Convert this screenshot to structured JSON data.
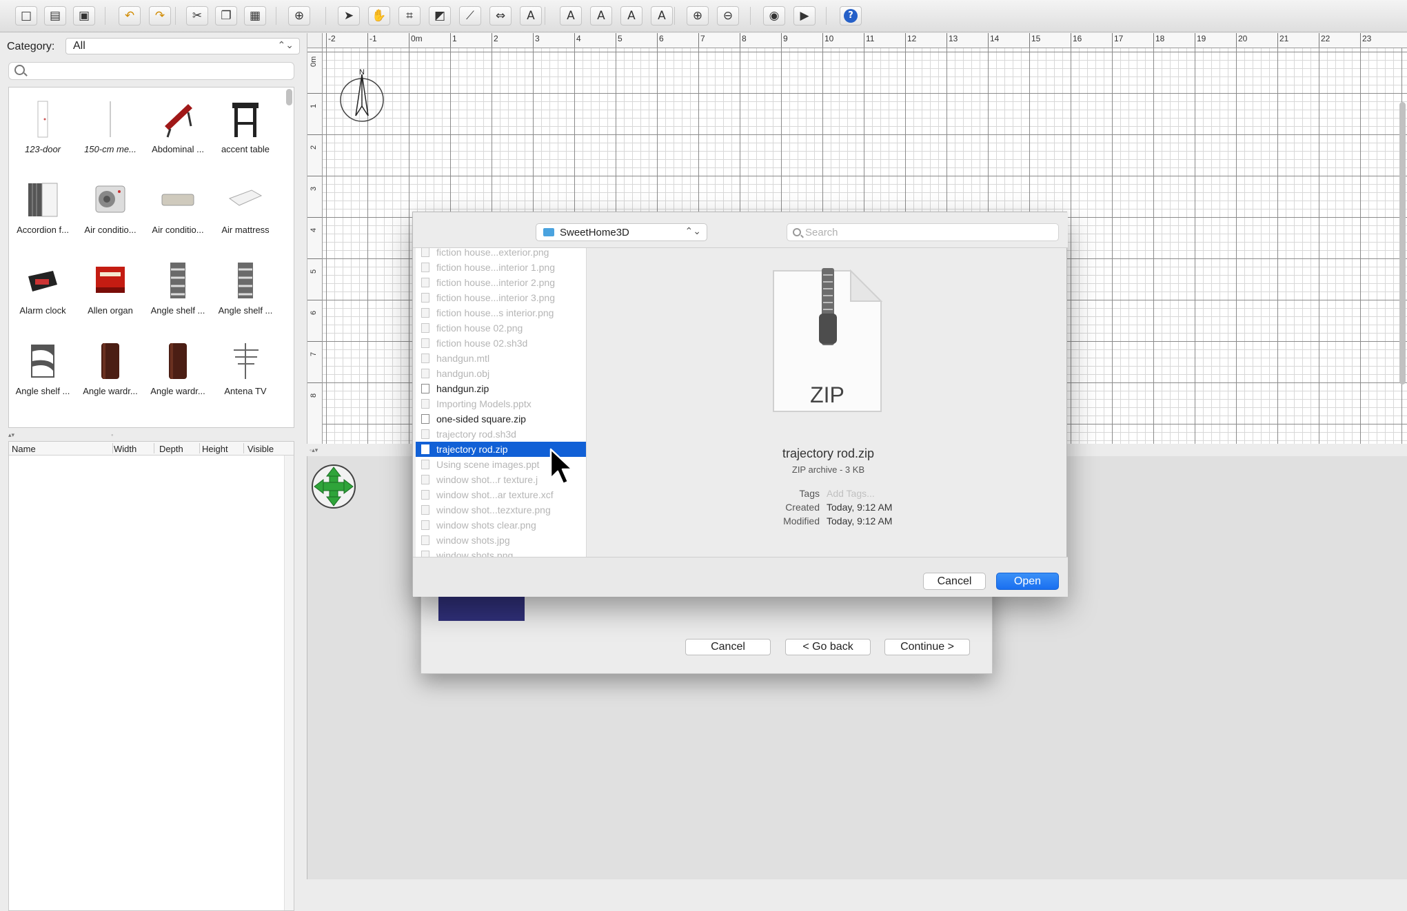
{
  "toolbar": {
    "buttons": [
      {
        "name": "new-home-button",
        "icon": "□"
      },
      {
        "name": "open-button",
        "icon": "▤"
      },
      {
        "name": "save-button",
        "icon": "▣"
      },
      {
        "name": "undo-button",
        "icon": "↶"
      },
      {
        "name": "redo-button",
        "icon": "↷"
      },
      {
        "name": "cut-button",
        "icon": "✂"
      },
      {
        "name": "copy-button",
        "icon": "❐"
      },
      {
        "name": "paste-button",
        "icon": "▦"
      },
      {
        "name": "add-furniture-button",
        "icon": "⊕"
      },
      {
        "name": "select-mode-button",
        "icon": "➤"
      },
      {
        "name": "pan-mode-button",
        "icon": "✋"
      },
      {
        "name": "create-walls-button",
        "icon": "⌗"
      },
      {
        "name": "create-rooms-button",
        "icon": "◩"
      },
      {
        "name": "create-polylines-button",
        "icon": "⟋"
      },
      {
        "name": "create-dimensions-button",
        "icon": "⇔"
      },
      {
        "name": "add-text-button",
        "icon": "A"
      },
      {
        "name": "increase-text-size-button",
        "icon": "A"
      },
      {
        "name": "decrease-text-size-button",
        "icon": "A"
      },
      {
        "name": "bold-text-button",
        "icon": "A"
      },
      {
        "name": "italic-text-button",
        "icon": "A"
      },
      {
        "name": "zoom-in-button",
        "icon": "⊕"
      },
      {
        "name": "zoom-out-button",
        "icon": "⊖"
      },
      {
        "name": "create-photo-button",
        "icon": "◉"
      },
      {
        "name": "create-video-button",
        "icon": "▶"
      },
      {
        "name": "help-button",
        "icon": "?"
      }
    ]
  },
  "left": {
    "category_label": "Category:",
    "category_value": "All",
    "catalog": [
      {
        "label": "123-door",
        "italic": true,
        "kind": "door"
      },
      {
        "label": "150-cm me...",
        "italic": true,
        "kind": "meter"
      },
      {
        "label": "Abdominal ...",
        "italic": false,
        "kind": "bench"
      },
      {
        "label": "accent table",
        "italic": false,
        "kind": "table"
      },
      {
        "label": "Accordion f...",
        "italic": false,
        "kind": "accordion"
      },
      {
        "label": "Air conditio...",
        "italic": false,
        "kind": "ac"
      },
      {
        "label": "Air conditio...",
        "italic": false,
        "kind": "ac2"
      },
      {
        "label": "Air mattress",
        "italic": false,
        "kind": "mattress"
      },
      {
        "label": "Alarm clock",
        "italic": false,
        "kind": "clock"
      },
      {
        "label": "Allen organ",
        "italic": false,
        "kind": "organ"
      },
      {
        "label": "Angle shelf ...",
        "italic": false,
        "kind": "shelf"
      },
      {
        "label": "Angle shelf ...",
        "italic": false,
        "kind": "shelf"
      },
      {
        "label": "Angle shelf ...",
        "italic": false,
        "kind": "shelf2"
      },
      {
        "label": "Angle wardr...",
        "italic": false,
        "kind": "wardrobe"
      },
      {
        "label": "Angle wardr...",
        "italic": false,
        "kind": "wardrobe"
      },
      {
        "label": "Antena TV",
        "italic": false,
        "kind": "antenna"
      }
    ],
    "table_columns": [
      "Name",
      "Width",
      "Depth",
      "Height",
      "Visible"
    ]
  },
  "plan": {
    "ruler_x": [
      "-2",
      "-1",
      "0m",
      "1",
      "2",
      "3",
      "4",
      "5",
      "6",
      "7",
      "8",
      "9",
      "10",
      "11",
      "12",
      "13",
      "14",
      "15",
      "16",
      "17",
      "18",
      "19",
      "20",
      "21",
      "22",
      "23"
    ],
    "ruler_y": [
      "0m",
      "1",
      "2",
      "3",
      "4",
      "5",
      "6",
      "7",
      "8"
    ],
    "compass_label": "N"
  },
  "wizard": {
    "cancel": "Cancel",
    "back": "< Go back",
    "continue": "Continue >",
    "swatch_color": "#30307a"
  },
  "open_dialog": {
    "location": "SweetHome3D",
    "search_placeholder": "Search",
    "files": [
      {
        "name": "fiction house...exterior.png",
        "enabled": false,
        "selected": false
      },
      {
        "name": "fiction house...interior 1.png",
        "enabled": false,
        "selected": false
      },
      {
        "name": "fiction house...interior 2.png",
        "enabled": false,
        "selected": false
      },
      {
        "name": "fiction house...interior 3.png",
        "enabled": false,
        "selected": false
      },
      {
        "name": "fiction house...s interior.png",
        "enabled": false,
        "selected": false
      },
      {
        "name": "fiction house 02.png",
        "enabled": false,
        "selected": false
      },
      {
        "name": "fiction house 02.sh3d",
        "enabled": false,
        "selected": false
      },
      {
        "name": "handgun.mtl",
        "enabled": false,
        "selected": false
      },
      {
        "name": "handgun.obj",
        "enabled": false,
        "selected": false
      },
      {
        "name": "handgun.zip",
        "enabled": true,
        "selected": false
      },
      {
        "name": "Importing Models.pptx",
        "enabled": false,
        "selected": false
      },
      {
        "name": "one-sided square.zip",
        "enabled": true,
        "selected": false
      },
      {
        "name": "trajectory rod.sh3d",
        "enabled": false,
        "selected": false
      },
      {
        "name": "trajectory rod.zip",
        "enabled": true,
        "selected": true
      },
      {
        "name": "Using scene images.ppt",
        "enabled": false,
        "selected": false
      },
      {
        "name": "window shot...r texture.j",
        "enabled": false,
        "selected": false
      },
      {
        "name": "window shot...ar texture.xcf",
        "enabled": false,
        "selected": false
      },
      {
        "name": "window shot...tezxture.png",
        "enabled": false,
        "selected": false
      },
      {
        "name": "window shots clear.png",
        "enabled": false,
        "selected": false
      },
      {
        "name": "window shots.jpg",
        "enabled": false,
        "selected": false
      },
      {
        "name": "window shots.png",
        "enabled": false,
        "selected": false
      }
    ],
    "preview": {
      "icon_label": "ZIP",
      "file_name": "trajectory rod.zip",
      "kind": "ZIP archive - 3 KB",
      "tags_key": "Tags",
      "tags_value": "Add Tags...",
      "created_key": "Created",
      "created_value": "Today, 9:12 AM",
      "modified_key": "Modified",
      "modified_value": "Today, 9:12 AM"
    },
    "cancel": "Cancel",
    "open": "Open",
    "accent_color": "#1160d6"
  }
}
